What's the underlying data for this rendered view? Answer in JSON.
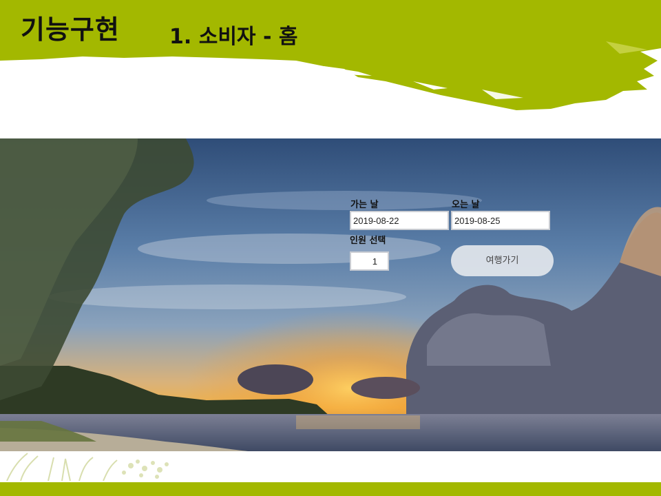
{
  "header": {
    "title": "기능구현",
    "subtitle": "1. 소비자 - 홈"
  },
  "form": {
    "departure_label": "가는 날",
    "departure_value": "2019-08-22",
    "return_label": "오는 날",
    "return_value": "2019-08-25",
    "people_label": "인원 선택",
    "people_value": "1",
    "submit_label": "여행가기"
  },
  "colors": {
    "brand_green": "#a3b800",
    "button_bg": "#e2e6ec"
  }
}
